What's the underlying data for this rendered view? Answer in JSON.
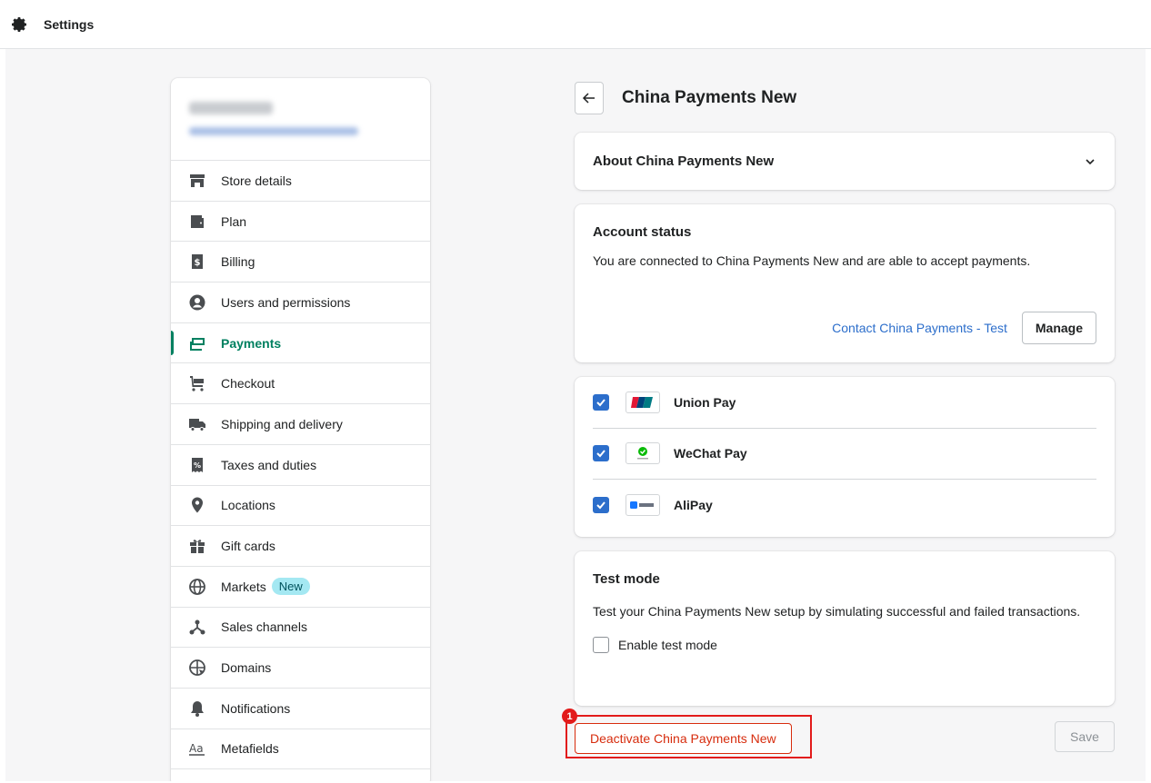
{
  "topbar": {
    "title": "Settings",
    "icon": "gear-icon"
  },
  "sidebar": {
    "items": [
      {
        "label": "Store details",
        "icon": "store-icon"
      },
      {
        "label": "Plan",
        "icon": "wallet-icon"
      },
      {
        "label": "Billing",
        "icon": "billing-icon"
      },
      {
        "label": "Users and permissions",
        "icon": "user-icon"
      },
      {
        "label": "Payments",
        "icon": "payments-icon",
        "active": true
      },
      {
        "label": "Checkout",
        "icon": "cart-icon"
      },
      {
        "label": "Shipping and delivery",
        "icon": "truck-icon"
      },
      {
        "label": "Taxes and duties",
        "icon": "tax-icon"
      },
      {
        "label": "Locations",
        "icon": "location-icon"
      },
      {
        "label": "Gift cards",
        "icon": "gift-icon"
      },
      {
        "label": "Markets",
        "icon": "globe-icon",
        "badge": "New"
      },
      {
        "label": "Sales channels",
        "icon": "channels-icon"
      },
      {
        "label": "Domains",
        "icon": "domains-icon"
      },
      {
        "label": "Notifications",
        "icon": "bell-icon"
      },
      {
        "label": "Metafields",
        "icon": "metafields-icon"
      }
    ]
  },
  "main": {
    "title": "China Payments New",
    "about": {
      "heading": "About China Payments New"
    },
    "account_status": {
      "heading": "Account status",
      "text": "You are connected to China Payments New and are able to accept payments.",
      "contact_link": "Contact China Payments - Test",
      "manage_label": "Manage"
    },
    "methods": [
      {
        "name": "Union Pay",
        "checked": true
      },
      {
        "name": "WeChat Pay",
        "checked": true
      },
      {
        "name": "AliPay",
        "checked": true
      }
    ],
    "test_mode": {
      "heading": "Test mode",
      "text": "Test your China Payments New setup by simulating successful and failed transactions.",
      "checkbox_label": "Enable test mode"
    },
    "deactivate_label": "Deactivate China Payments New",
    "save_label": "Save",
    "marker": "1"
  },
  "colors": {
    "accent_green": "#008060",
    "link_blue": "#2c6ecb",
    "danger_red": "#d72c0d",
    "highlight_red": "#e21b1b"
  }
}
